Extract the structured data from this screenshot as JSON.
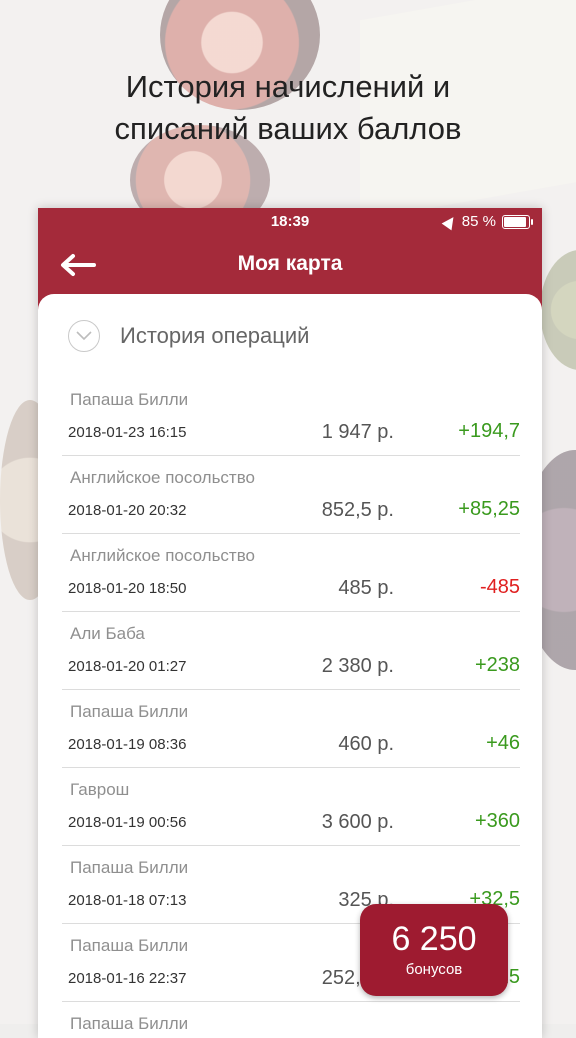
{
  "headline": {
    "line1": "История начислений и",
    "line2": "списаний ваших баллов"
  },
  "status_bar": {
    "time": "18:39",
    "battery": "85 %"
  },
  "nav": {
    "title": "Моя карта"
  },
  "section": {
    "title": "История операций"
  },
  "operations": [
    {
      "name": "Папаша Билли",
      "date": "2018-01-23 16:15",
      "amount": "1 947 р.",
      "points": "+194,7",
      "kind": "pos"
    },
    {
      "name": "Английское посольство",
      "date": "2018-01-20 20:32",
      "amount": "852,5 р.",
      "points": "+85,25",
      "kind": "pos"
    },
    {
      "name": "Английское посольство",
      "date": "2018-01-20 18:50",
      "amount": "485 р.",
      "points": "-485",
      "kind": "neg"
    },
    {
      "name": "Али Баба",
      "date": "2018-01-20 01:27",
      "amount": "2 380 р.",
      "points": "+238",
      "kind": "pos"
    },
    {
      "name": "Папаша Билли",
      "date": "2018-01-19 08:36",
      "amount": "460 р.",
      "points": "+46",
      "kind": "pos"
    },
    {
      "name": "Гаврош",
      "date": "2018-01-19 00:56",
      "amount": "3 600 р.",
      "points": "+360",
      "kind": "pos"
    },
    {
      "name": "Папаша Билли",
      "date": "2018-01-18 07:13",
      "amount": "325 р.",
      "points": "+32,5",
      "kind": "pos"
    },
    {
      "name": "Папаша Билли",
      "date": "2018-01-16 22:37",
      "amount": "252,5 р.",
      "points": "+25,25",
      "kind": "pos"
    },
    {
      "name": "Папаша Билли",
      "date": "",
      "amount": "",
      "points": "",
      "kind": "pos"
    }
  ],
  "bonus": {
    "value": "6 250",
    "label": "бонусов"
  },
  "colors": {
    "brand": "#a42a3a",
    "positive": "#3a9a1e",
    "negative": "#e02020"
  }
}
